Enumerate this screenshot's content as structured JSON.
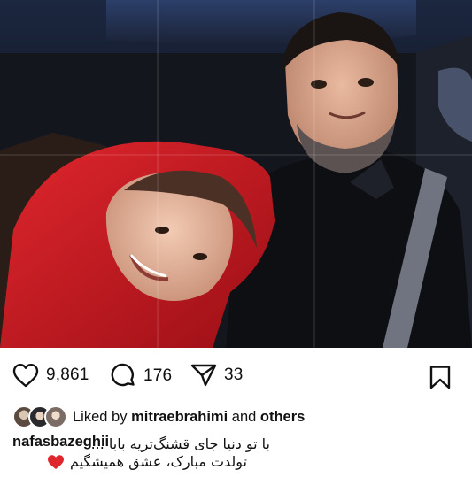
{
  "post": {
    "image_alt": "Photo of a smiling man and a girl in a red hood inside a car",
    "colors": {
      "hood": "#c8141c",
      "like_heart_emoji": "#e0262d",
      "text": "#111111"
    }
  },
  "actions": {
    "like_icon": "heart-outline-icon",
    "like_count": "9,861",
    "comment_icon": "comment-bubble-icon",
    "comment_count": "176",
    "share_icon": "paper-plane-icon",
    "share_count": "33",
    "save_icon": "bookmark-icon"
  },
  "liked_by": {
    "prefix": "Liked by",
    "user": "mitraebrahimi",
    "connector": "and",
    "others": "others"
  },
  "caption": {
    "username": "nafasbazeghii",
    "line1": "با تو دنیا جای قشنگ‌تریه بابا ...",
    "line2": "تولدت مبارک، عشق همیشگیم"
  }
}
